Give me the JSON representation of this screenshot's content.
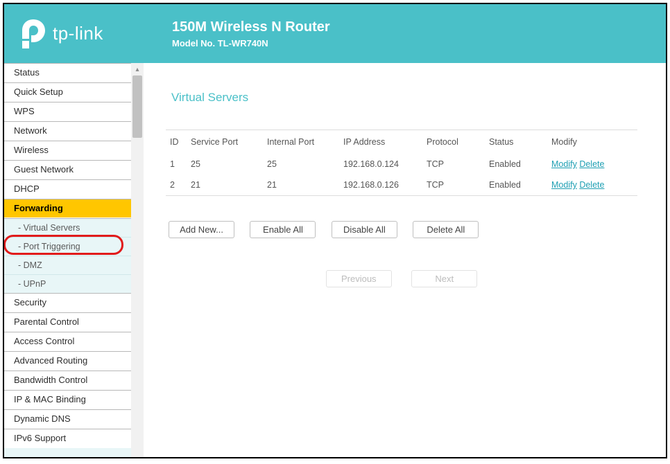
{
  "header": {
    "brand": "tp-link",
    "title": "150M Wireless N Router",
    "model": "Model No. TL-WR740N"
  },
  "sidebar": {
    "items": [
      {
        "label": "Status",
        "type": "item"
      },
      {
        "label": "Quick Setup",
        "type": "item"
      },
      {
        "label": "WPS",
        "type": "item"
      },
      {
        "label": "Network",
        "type": "item"
      },
      {
        "label": "Wireless",
        "type": "item"
      },
      {
        "label": "Guest Network",
        "type": "item"
      },
      {
        "label": "DHCP",
        "type": "item"
      },
      {
        "label": "Forwarding",
        "type": "item",
        "active": true
      },
      {
        "label": "- Virtual Servers",
        "type": "sub"
      },
      {
        "label": "- Port Triggering",
        "type": "sub",
        "highlight": true
      },
      {
        "label": "- DMZ",
        "type": "sub"
      },
      {
        "label": "- UPnP",
        "type": "sub"
      },
      {
        "label": "Security",
        "type": "item"
      },
      {
        "label": "Parental Control",
        "type": "item"
      },
      {
        "label": "Access Control",
        "type": "item"
      },
      {
        "label": "Advanced Routing",
        "type": "item"
      },
      {
        "label": "Bandwidth Control",
        "type": "item"
      },
      {
        "label": "IP & MAC Binding",
        "type": "item"
      },
      {
        "label": "Dynamic DNS",
        "type": "item"
      },
      {
        "label": "IPv6 Support",
        "type": "item"
      }
    ]
  },
  "main": {
    "title": "Virtual Servers",
    "columns": [
      "ID",
      "Service Port",
      "Internal Port",
      "IP Address",
      "Protocol",
      "Status",
      "Modify"
    ],
    "rows": [
      {
        "id": "1",
        "service_port": "25",
        "internal_port": "25",
        "ip": "192.168.0.124",
        "protocol": "TCP",
        "status": "Enabled"
      },
      {
        "id": "2",
        "service_port": "21",
        "internal_port": "21",
        "ip": "192.168.0.126",
        "protocol": "TCP",
        "status": "Enabled"
      }
    ],
    "modify_label": "Modify",
    "delete_label": "Delete",
    "buttons": {
      "add_new": "Add New...",
      "enable_all": "Enable All",
      "disable_all": "Disable All",
      "delete_all": "Delete All",
      "previous": "Previous",
      "next": "Next"
    }
  }
}
